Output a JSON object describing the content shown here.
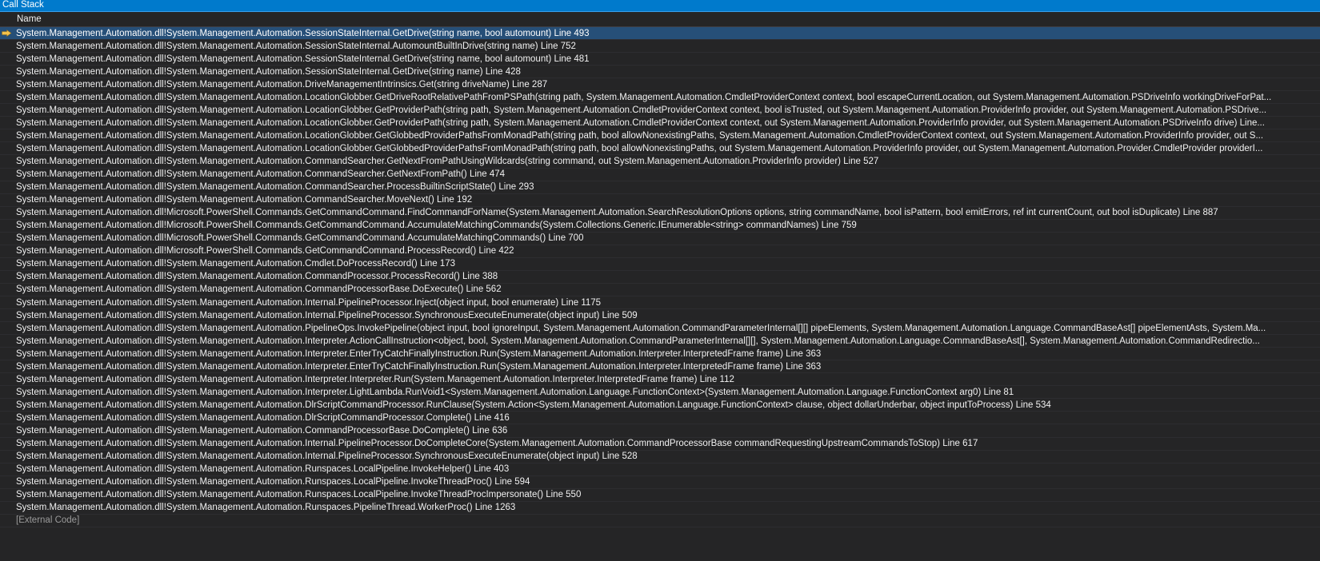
{
  "window": {
    "title": "Call Stack"
  },
  "columns": {
    "name": "Name"
  },
  "colors": {
    "accent": "#007acc",
    "selection": "#264f78",
    "current_frame_arrow": "#f2c14b"
  },
  "current_frame_icon": "current-frame-arrow-icon",
  "frames": [
    "System.Management.Automation.dll!System.Management.Automation.SessionStateInternal.GetDrive(string name, bool automount) Line 493",
    "System.Management.Automation.dll!System.Management.Automation.SessionStateInternal.AutomountBuiltInDrive(string name) Line 752",
    "System.Management.Automation.dll!System.Management.Automation.SessionStateInternal.GetDrive(string name, bool automount) Line 481",
    "System.Management.Automation.dll!System.Management.Automation.SessionStateInternal.GetDrive(string name) Line 428",
    "System.Management.Automation.dll!System.Management.Automation.DriveManagementIntrinsics.Get(string driveName) Line 287",
    "System.Management.Automation.dll!System.Management.Automation.LocationGlobber.GetDriveRootRelativePathFromPSPath(string path, System.Management.Automation.CmdletProviderContext context, bool escapeCurrentLocation, out System.Management.Automation.PSDriveInfo workingDriveForPat...",
    "System.Management.Automation.dll!System.Management.Automation.LocationGlobber.GetProviderPath(string path, System.Management.Automation.CmdletProviderContext context, bool isTrusted, out System.Management.Automation.ProviderInfo provider, out System.Management.Automation.PSDrive...",
    "System.Management.Automation.dll!System.Management.Automation.LocationGlobber.GetProviderPath(string path, System.Management.Automation.CmdletProviderContext context, out System.Management.Automation.ProviderInfo provider, out System.Management.Automation.PSDriveInfo drive) Line...",
    "System.Management.Automation.dll!System.Management.Automation.LocationGlobber.GetGlobbedProviderPathsFromMonadPath(string path, bool allowNonexistingPaths, System.Management.Automation.CmdletProviderContext context, out System.Management.Automation.ProviderInfo provider, out S...",
    "System.Management.Automation.dll!System.Management.Automation.LocationGlobber.GetGlobbedProviderPathsFromMonadPath(string path, bool allowNonexistingPaths, out System.Management.Automation.ProviderInfo provider, out System.Management.Automation.Provider.CmdletProvider providerI...",
    "System.Management.Automation.dll!System.Management.Automation.CommandSearcher.GetNextFromPathUsingWildcards(string command, out System.Management.Automation.ProviderInfo provider) Line 527",
    "System.Management.Automation.dll!System.Management.Automation.CommandSearcher.GetNextFromPath() Line 474",
    "System.Management.Automation.dll!System.Management.Automation.CommandSearcher.ProcessBuiltinScriptState() Line 293",
    "System.Management.Automation.dll!System.Management.Automation.CommandSearcher.MoveNext() Line 192",
    "System.Management.Automation.dll!Microsoft.PowerShell.Commands.GetCommandCommand.FindCommandForName(System.Management.Automation.SearchResolutionOptions options, string commandName, bool isPattern, bool emitErrors, ref int currentCount, out bool isDuplicate) Line 887",
    "System.Management.Automation.dll!Microsoft.PowerShell.Commands.GetCommandCommand.AccumulateMatchingCommands(System.Collections.Generic.IEnumerable<string> commandNames) Line 759",
    "System.Management.Automation.dll!Microsoft.PowerShell.Commands.GetCommandCommand.AccumulateMatchingCommands() Line 700",
    "System.Management.Automation.dll!Microsoft.PowerShell.Commands.GetCommandCommand.ProcessRecord() Line 422",
    "System.Management.Automation.dll!System.Management.Automation.Cmdlet.DoProcessRecord() Line 173",
    "System.Management.Automation.dll!System.Management.Automation.CommandProcessor.ProcessRecord() Line 388",
    "System.Management.Automation.dll!System.Management.Automation.CommandProcessorBase.DoExecute() Line 562",
    "System.Management.Automation.dll!System.Management.Automation.Internal.PipelineProcessor.Inject(object input, bool enumerate) Line 1175",
    "System.Management.Automation.dll!System.Management.Automation.Internal.PipelineProcessor.SynchronousExecuteEnumerate(object input) Line 509",
    "System.Management.Automation.dll!System.Management.Automation.PipelineOps.InvokePipeline(object input, bool ignoreInput, System.Management.Automation.CommandParameterInternal[][] pipeElements, System.Management.Automation.Language.CommandBaseAst[] pipeElementAsts, System.Ma...",
    "System.Management.Automation.dll!System.Management.Automation.Interpreter.ActionCallInstruction<object, bool, System.Management.Automation.CommandParameterInternal[][], System.Management.Automation.Language.CommandBaseAst[], System.Management.Automation.CommandRedirectio...",
    "System.Management.Automation.dll!System.Management.Automation.Interpreter.EnterTryCatchFinallyInstruction.Run(System.Management.Automation.Interpreter.InterpretedFrame frame) Line 363",
    "System.Management.Automation.dll!System.Management.Automation.Interpreter.EnterTryCatchFinallyInstruction.Run(System.Management.Automation.Interpreter.InterpretedFrame frame) Line 363",
    "System.Management.Automation.dll!System.Management.Automation.Interpreter.Interpreter.Run(System.Management.Automation.Interpreter.InterpretedFrame frame) Line 112",
    "System.Management.Automation.dll!System.Management.Automation.Interpreter.LightLambda.RunVoid1<System.Management.Automation.Language.FunctionContext>(System.Management.Automation.Language.FunctionContext arg0) Line 81",
    "System.Management.Automation.dll!System.Management.Automation.DlrScriptCommandProcessor.RunClause(System.Action<System.Management.Automation.Language.FunctionContext> clause, object dollarUnderbar, object inputToProcess) Line 534",
    "System.Management.Automation.dll!System.Management.Automation.DlrScriptCommandProcessor.Complete() Line 416",
    "System.Management.Automation.dll!System.Management.Automation.CommandProcessorBase.DoComplete() Line 636",
    "System.Management.Automation.dll!System.Management.Automation.Internal.PipelineProcessor.DoCompleteCore(System.Management.Automation.CommandProcessorBase commandRequestingUpstreamCommandsToStop) Line 617",
    "System.Management.Automation.dll!System.Management.Automation.Internal.PipelineProcessor.SynchronousExecuteEnumerate(object input) Line 528",
    "System.Management.Automation.dll!System.Management.Automation.Runspaces.LocalPipeline.InvokeHelper() Line 403",
    "System.Management.Automation.dll!System.Management.Automation.Runspaces.LocalPipeline.InvokeThreadProc() Line 594",
    "System.Management.Automation.dll!System.Management.Automation.Runspaces.LocalPipeline.InvokeThreadProcImpersonate() Line 550",
    "System.Management.Automation.dll!System.Management.Automation.Runspaces.PipelineThread.WorkerProc() Line 1263",
    "[External Code]"
  ]
}
